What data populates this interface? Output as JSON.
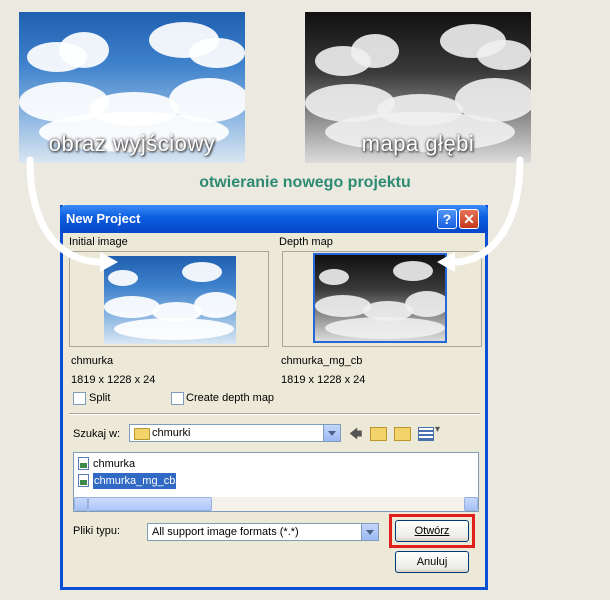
{
  "captions": {
    "source_image": "obraz wyjściowy",
    "depth_map": "mapa głębi",
    "headline": "otwieranie nowego projektu"
  },
  "dialog": {
    "title": "New Project",
    "help_glyph": "?",
    "close_glyph": "✕",
    "initial_image": {
      "label": "Initial image",
      "name": "chmurka",
      "size": "1819 x 1228 x 24"
    },
    "depth_map": {
      "label": "Depth map",
      "name": "chmurka_mg_cb",
      "size": "1819 x 1228 x 24"
    },
    "options": {
      "split": "Split",
      "create_depth_map": "Create depth map"
    },
    "look_in": {
      "label": "Szukaj w:",
      "value": "chmurki"
    },
    "files": [
      "chmurka",
      "chmurka_mg_cb"
    ],
    "selected_file": "chmurka_mg_cb",
    "file_type": {
      "label": "Pliki typu:",
      "value": "All support image formats (*.*)"
    },
    "buttons": {
      "open": "Otwórz",
      "cancel": "Anuluj"
    }
  },
  "icons": {
    "back": "left-arrow-icon",
    "up": "up-folder-icon",
    "new_folder": "new-folder-icon",
    "view": "view-menu-icon"
  },
  "colors": {
    "headline": "#2e8b73",
    "titlebar": "#0a5ce0",
    "highlight": "#e0201c"
  }
}
